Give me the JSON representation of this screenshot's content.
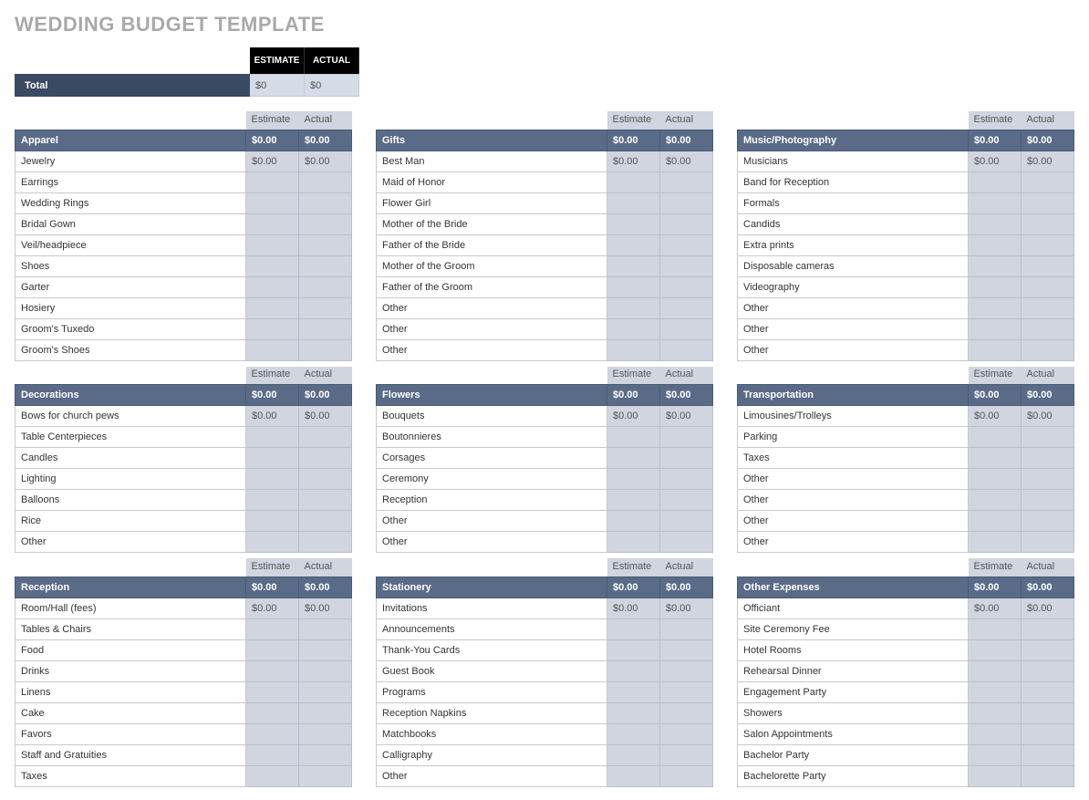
{
  "title": "WEDDING BUDGET TEMPLATE",
  "headers": {
    "estimate": "ESTIMATE",
    "actual": "ACTUAL",
    "estimate_small": "Estimate",
    "actual_small": "Actual"
  },
  "total": {
    "label": "Total",
    "estimate": "$0",
    "actual": "$0"
  },
  "zero": "$0.00",
  "columns": [
    [
      {
        "name": "Apparel",
        "items": [
          "Jewelry",
          "Earrings",
          "Wedding Rings",
          "Bridal Gown",
          "Veil/headpiece",
          "Shoes",
          "Garter",
          "Hosiery",
          "Groom's Tuxedo",
          "Groom's Shoes"
        ]
      },
      {
        "name": "Decorations",
        "items": [
          "Bows for church pews",
          "Table Centerpieces",
          "Candles",
          "Lighting",
          "Balloons",
          "Rice",
          "Other"
        ]
      },
      {
        "name": "Reception",
        "items": [
          "Room/Hall (fees)",
          "Tables & Chairs",
          "Food",
          "Drinks",
          "Linens",
          "Cake",
          "Favors",
          "Staff and Gratuities",
          "Taxes"
        ]
      }
    ],
    [
      {
        "name": "Gifts",
        "items": [
          "Best Man",
          "Maid of Honor",
          "Flower Girl",
          "Mother of the Bride",
          "Father of the Bride",
          "Mother of the Groom",
          "Father of the Groom",
          "Other",
          "Other",
          "Other"
        ]
      },
      {
        "name": "Flowers",
        "items": [
          "Bouquets",
          "Boutonnieres",
          "Corsages",
          "Ceremony",
          "Reception",
          "Other",
          "Other"
        ]
      },
      {
        "name": "Stationery",
        "items": [
          "Invitations",
          "Announcements",
          "Thank-You Cards",
          "Guest Book",
          "Programs",
          "Reception Napkins",
          "Matchbooks",
          "Calligraphy",
          "Other"
        ]
      }
    ],
    [
      {
        "name": "Music/Photography",
        "items": [
          "Musicians",
          "Band for Reception",
          "Formals",
          "Candids",
          "Extra prints",
          "Disposable cameras",
          "Videography",
          "Other",
          "Other",
          "Other"
        ]
      },
      {
        "name": "Transportation",
        "items": [
          "Limousines/Trolleys",
          "Parking",
          "Taxes",
          "Other",
          "Other",
          "Other",
          "Other"
        ]
      },
      {
        "name": "Other Expenses",
        "items": [
          "Officiant",
          "Site Ceremony Fee",
          "Hotel Rooms",
          "Rehearsal Dinner",
          "Engagement Party",
          "Showers",
          "Salon Appointments",
          "Bachelor Party",
          "Bachelorette Party"
        ]
      }
    ]
  ]
}
